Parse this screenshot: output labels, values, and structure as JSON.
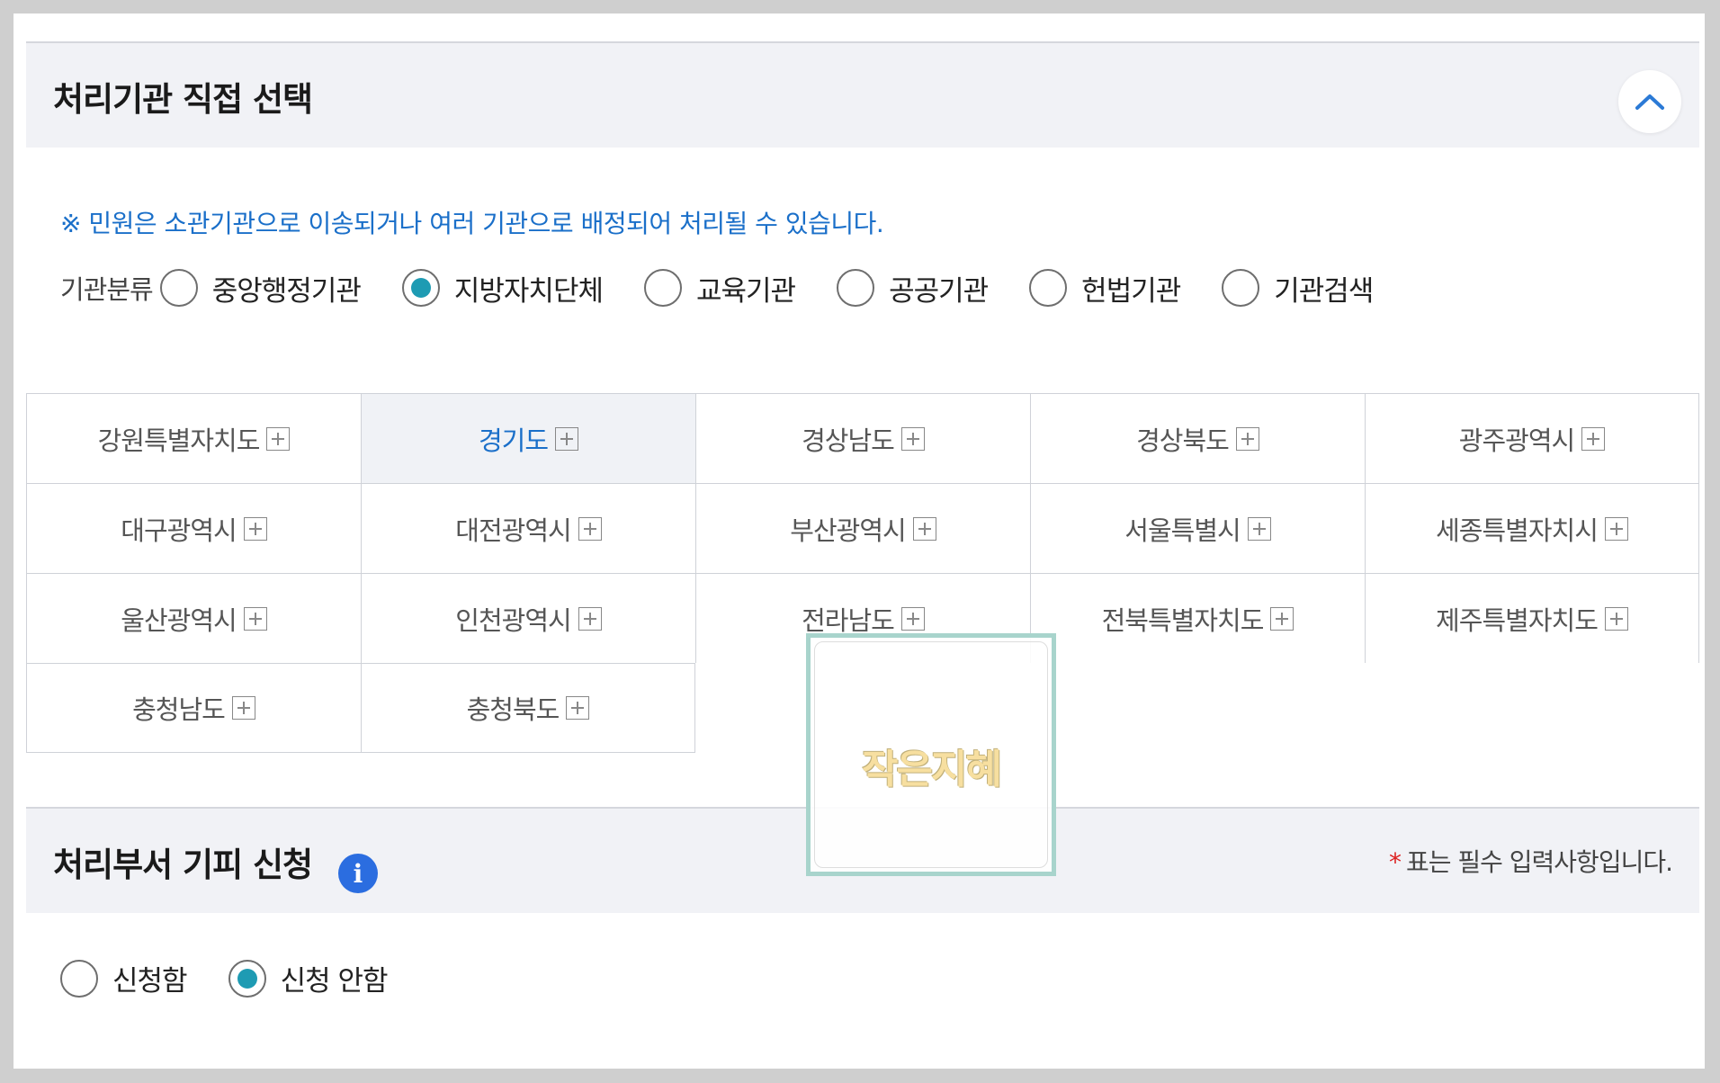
{
  "section1": {
    "title": "처리기관 직접 선택",
    "notice": "※ 민원은 소관기관으로 이송되거나 여러 기관으로 배정되어 처리될 수 있습니다.",
    "org_label": "기관분류",
    "org_options": [
      {
        "label": "중앙행정기관",
        "checked": false
      },
      {
        "label": "지방자치단체",
        "checked": true
      },
      {
        "label": "교육기관",
        "checked": false
      },
      {
        "label": "공공기관",
        "checked": false
      },
      {
        "label": "헌법기관",
        "checked": false
      },
      {
        "label": "기관검색",
        "checked": false
      }
    ],
    "regions": [
      "강원특별자치도",
      "경기도",
      "경상남도",
      "경상북도",
      "광주광역시",
      "대구광역시",
      "대전광역시",
      "부산광역시",
      "서울특별시",
      "세종특별자치시",
      "울산광역시",
      "인천광역시",
      "전라남도",
      "전북특별자치도",
      "제주특별자치도",
      "충청남도",
      "충청북도"
    ],
    "active_region": "경기도"
  },
  "section2": {
    "title": "처리부서 기피 신청",
    "info_glyph": "i",
    "required_star": "*",
    "required_note": "표는 필수 입력사항입니다.",
    "apply_options": [
      {
        "label": "신청함",
        "checked": false
      },
      {
        "label": "신청 안함",
        "checked": true
      }
    ]
  },
  "watermark": {
    "text": "작은지혜"
  },
  "colors": {
    "accent": "#1e9bb3",
    "link": "#1a6fc9",
    "info": "#2b6de0"
  }
}
